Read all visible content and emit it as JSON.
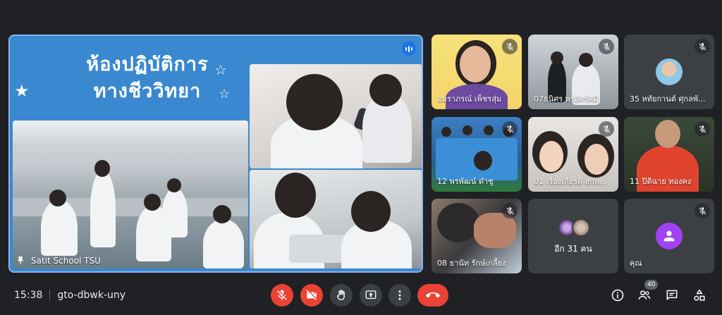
{
  "presentation": {
    "title_lines": [
      "ห้องปฏิบัติการ",
      "ทางชีววิทยา"
    ],
    "presenter_label": "Satit School TSU"
  },
  "participants": [
    {
      "name": "อมราภรณ์ เพ็ชรสุ่ม",
      "muted": true
    },
    {
      "name": "07ธนิศร พรอัศรัศมี",
      "muted": true
    },
    {
      "name": "35 หทัยกานต์ ศุกลพั...",
      "muted": true
    },
    {
      "name": "12 พรพัฒน์ ดำชู",
      "muted": true
    },
    {
      "name": "01 เรืองเกียรติ สกล...",
      "muted": true
    },
    {
      "name": "11 ปิติฉาย ทองคง",
      "muted": true
    },
    {
      "name": "08 ธานัท รักษ์เกลี้ยง",
      "muted": true
    },
    {
      "name": "อีก 31 คน",
      "muted": false
    },
    {
      "name": "คุณ",
      "muted": true
    }
  ],
  "meeting": {
    "time": "15:38",
    "code": "gto-dbwk-uny"
  },
  "toolbar": {
    "participant_count": "40"
  },
  "colors": {
    "mute_red": "#ea4335",
    "accent_blue": "#8ab4f8",
    "avatar_purple": "#a142f4"
  }
}
